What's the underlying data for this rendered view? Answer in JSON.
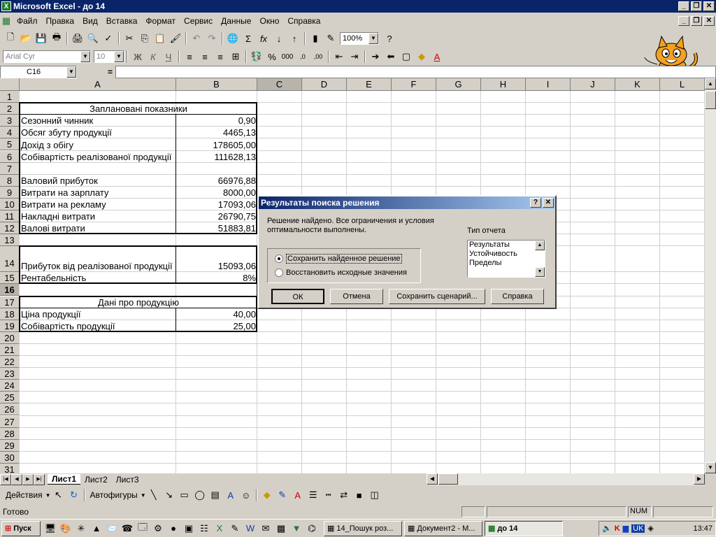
{
  "window": {
    "title": "Microsoft Excel - до 14"
  },
  "menu": [
    "Файл",
    "Правка",
    "Вид",
    "Вставка",
    "Формат",
    "Сервис",
    "Данные",
    "Окно",
    "Справка"
  ],
  "toolbar": {
    "zoom": "100%",
    "font": "Arial Cyr",
    "font_size": "10"
  },
  "formula_bar": {
    "name_box": "C16",
    "equals": "="
  },
  "columns": [
    "A",
    "B",
    "C",
    "D",
    "E",
    "F",
    "G",
    "H",
    "I",
    "J",
    "K",
    "L"
  ],
  "rows": [
    "1",
    "2",
    "3",
    "4",
    "5",
    "6",
    "7",
    "8",
    "9",
    "10",
    "11",
    "12",
    "13",
    "14",
    "15",
    "16",
    "17",
    "18",
    "19",
    "20",
    "21",
    "22",
    "23",
    "24",
    "25",
    "26",
    "27",
    "28",
    "29",
    "30",
    "31"
  ],
  "cells": {
    "a2": "Заплановані показники",
    "a3": "Сезонний чинник",
    "b3": "0,90",
    "a4": "Обсяг збуту продукції",
    "b4": "4465,13",
    "a5": "Дохід з обігу",
    "b5": "178605,00",
    "a6": "Собівартість реалізованої продукції",
    "b6": "111628,13",
    "a8": "Валовий прибуток",
    "b8": "66976,88",
    "a9": "Витрати на зарплату",
    "b9": "8000,00",
    "a10": "Витрати на рекламу",
    "b10": "17093,06",
    "a11": "Накладні витрати",
    "b11": "26790,75",
    "a12": "Валові витрати",
    "b12": "51883,81",
    "a14": "Прибуток від реалізованої продукції",
    "b14": "15093,06",
    "a15": "Рентабельність",
    "b15": "8%",
    "a17": "Дані про продукцію",
    "a18": "Ціна продукції",
    "b18": "40,00",
    "a19": "Собівартість продукції",
    "b19": "25,00"
  },
  "sheets": [
    "Лист1",
    "Лист2",
    "Лист3"
  ],
  "drawing": {
    "actions": "Действия",
    "autoshapes": "Автофигуры"
  },
  "status": {
    "ready": "Готово",
    "num": "NUM"
  },
  "dialog": {
    "title": "Результаты поиска решения",
    "message": "Решение найдено. Все ограничения и условия оптимальности выполнены.",
    "report_label": "Тип отчета",
    "reports": [
      "Результаты",
      "Устойчивость",
      "Пределы"
    ],
    "radio_keep": "Сохранить найденное решение",
    "radio_restore": "Восстановить исходные значения",
    "ok": "ОК",
    "cancel": "Отмена",
    "save_scenario": "Сохранить сценарий...",
    "help": "Справка"
  },
  "taskbar": {
    "start": "Пуск",
    "tasks": [
      "14_Пошук роз...",
      "Документ2 - М...",
      "до 14"
    ],
    "clock": "13:47",
    "lang": "UK"
  }
}
